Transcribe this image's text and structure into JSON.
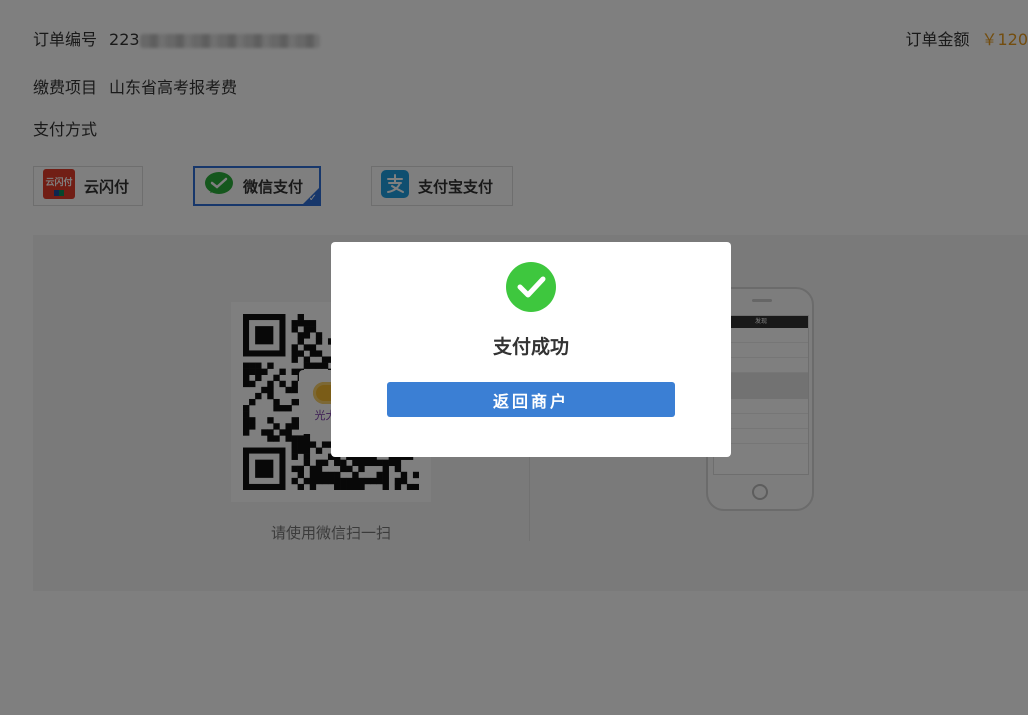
{
  "order": {
    "number_label": "订单编号",
    "number_prefix": "223",
    "amount_label": "订单金额",
    "amount_value": "￥120"
  },
  "item": {
    "label": "缴费项目",
    "value": "山东省高考报考费"
  },
  "payment": {
    "label": "支付方式",
    "options": [
      {
        "label": "云闪付",
        "icon": "unionpay-quickpass-icon",
        "badge_text": "云闪付",
        "selected": false
      },
      {
        "label": "微信支付",
        "icon": "wechat-pay-icon",
        "selected": true
      },
      {
        "label": "支付宝支付",
        "icon": "alipay-icon",
        "selected": false
      }
    ]
  },
  "scan": {
    "logo_text": "光大云",
    "hint": "请使用微信扫一扫",
    "phone_screen_title": "发现"
  },
  "modal": {
    "title": "支付成功",
    "button_label": "返回商户",
    "icon": "success-check-icon"
  },
  "colors": {
    "accent_blue": "#3b7fd4",
    "amount_orange": "#e69a1e",
    "success_green": "#3ec73e",
    "wechat_green": "#2aae3a",
    "alipay_blue": "#1e9fe0",
    "unionpay_red": "#e33c2b"
  }
}
